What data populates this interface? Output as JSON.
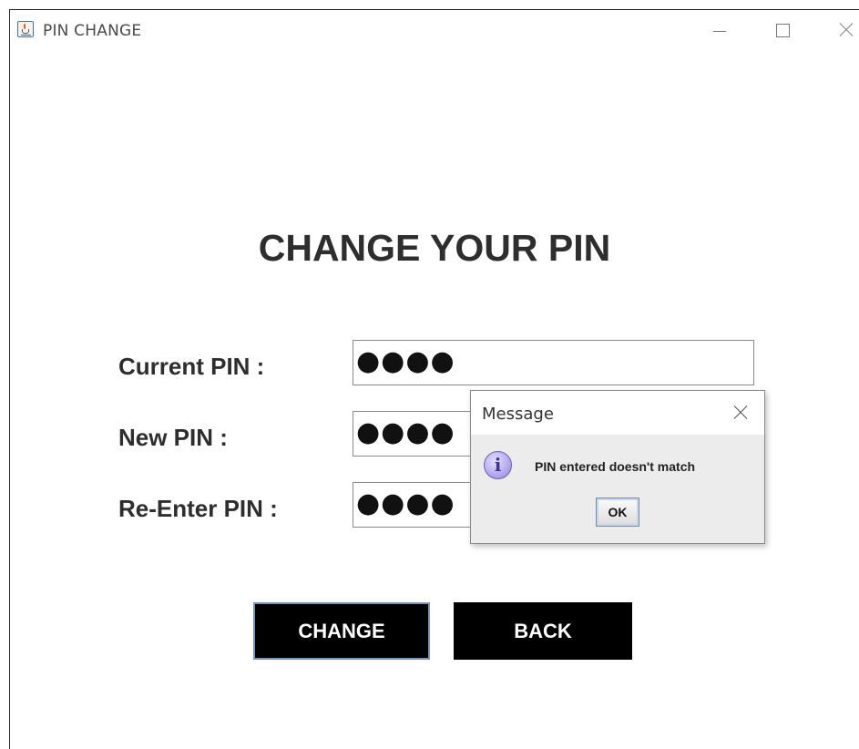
{
  "window": {
    "title": "PIN CHANGE"
  },
  "form": {
    "heading": "CHANGE YOUR PIN",
    "fields": [
      {
        "label": "Current PIN :",
        "value": "●●●●"
      },
      {
        "label": "New PIN :",
        "value": "●●●●"
      },
      {
        "label": "Re-Enter PIN :",
        "value": "●●●●"
      }
    ],
    "change_label": "CHANGE",
    "back_label": "BACK"
  },
  "dialog": {
    "title": "Message",
    "icon": "info-icon",
    "icon_glyph": "i",
    "message": "PIN entered doesn't match",
    "ok_label": "OK"
  },
  "colors": {
    "button_bg": "#000000",
    "button_text": "#ffffff",
    "focus_border": "#7a93b8",
    "dialog_bg": "#ececec"
  }
}
